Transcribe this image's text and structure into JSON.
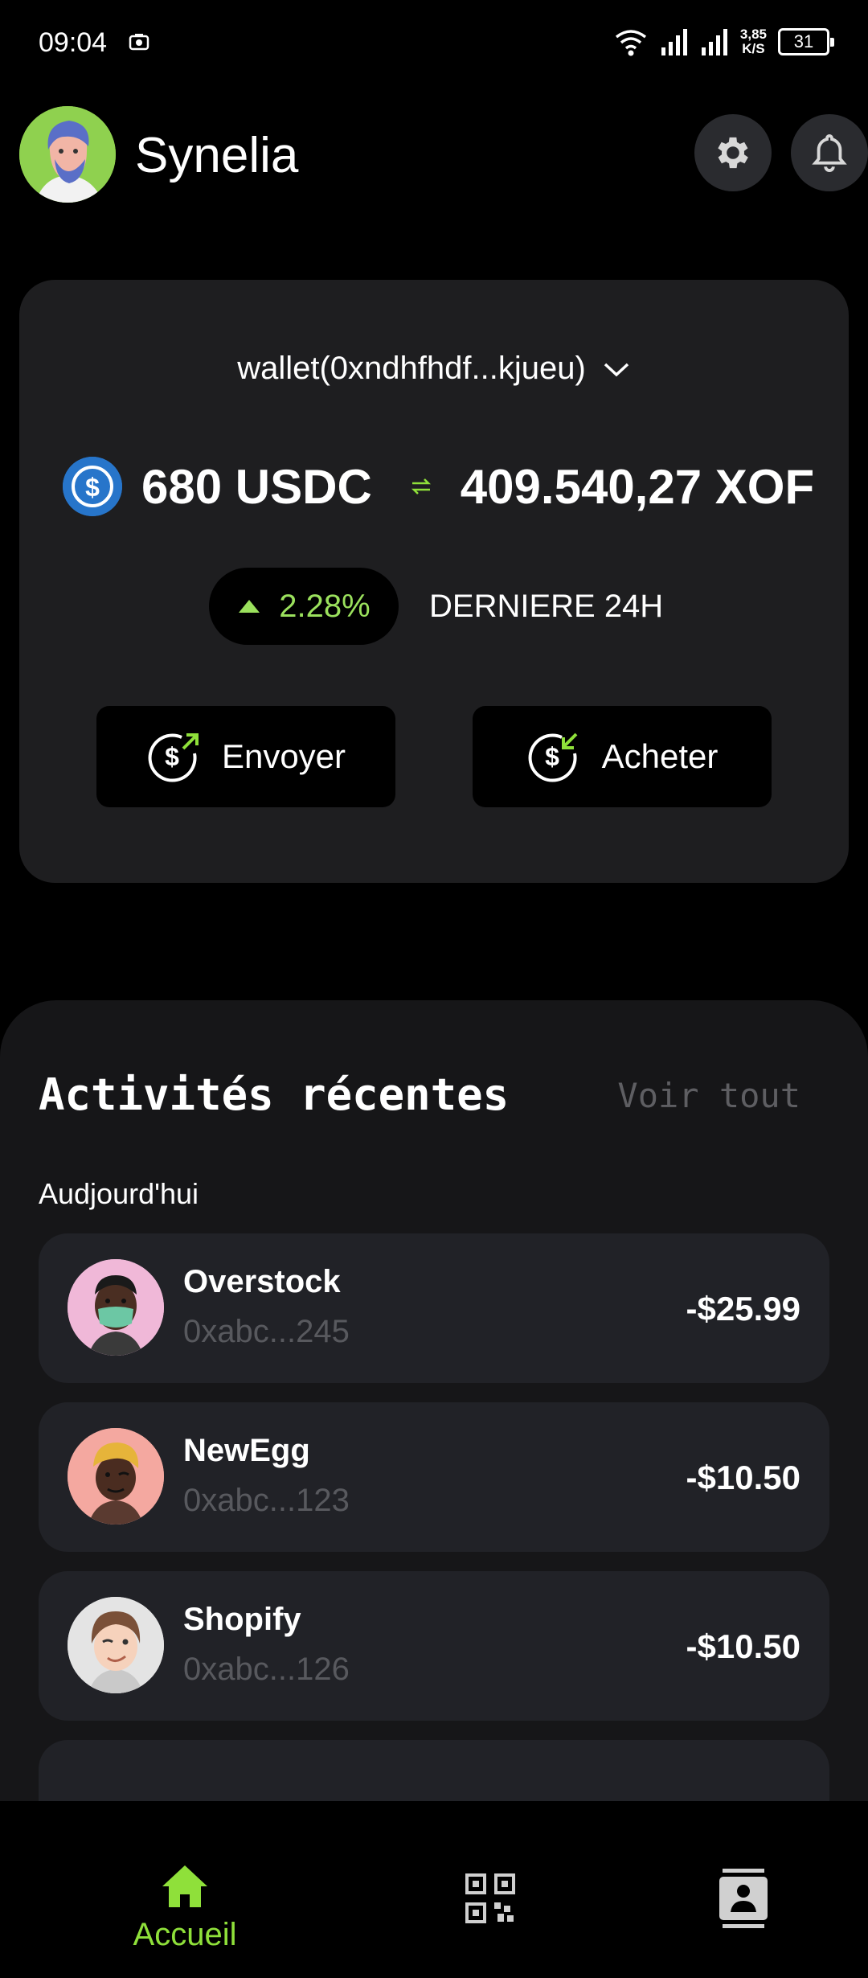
{
  "status_bar": {
    "time": "09:04",
    "net_speed_value": "3,85",
    "net_speed_unit": "K/S",
    "battery": "31"
  },
  "header": {
    "username": "Synelia",
    "avatar_icon": "user-avatar-icon",
    "settings_icon": "gear-icon",
    "notifications_icon": "bell-icon"
  },
  "wallet": {
    "selector": "wallet(0xndhfhdf...kjueu)",
    "balance_usdc": "680 USDC",
    "balance_xof": "409.540,27 XOF",
    "change": "2.28%",
    "change_period": "DERNIERE 24H",
    "send_label": "Envoyer",
    "buy_label": "Acheter"
  },
  "activities": {
    "title": "Activités récentes",
    "see_all": "Voir tout",
    "day_label": "Audjourd'hui",
    "items": [
      {
        "name": "Overstock",
        "address": "0xabc...245",
        "amount": "-$25.99"
      },
      {
        "name": "NewEgg",
        "address": "0xabc...123",
        "amount": "-$10.50"
      },
      {
        "name": "Shopify",
        "address": "0xabc...126",
        "amount": "-$10.50"
      }
    ]
  },
  "nav": {
    "home_label": "Accueil",
    "qr_icon": "qr-code-icon",
    "contacts_icon": "contacts-icon"
  },
  "colors": {
    "accent_green": "#8fe03a",
    "card_bg": "#1e1e20",
    "usdc_blue": "#2775ca"
  }
}
